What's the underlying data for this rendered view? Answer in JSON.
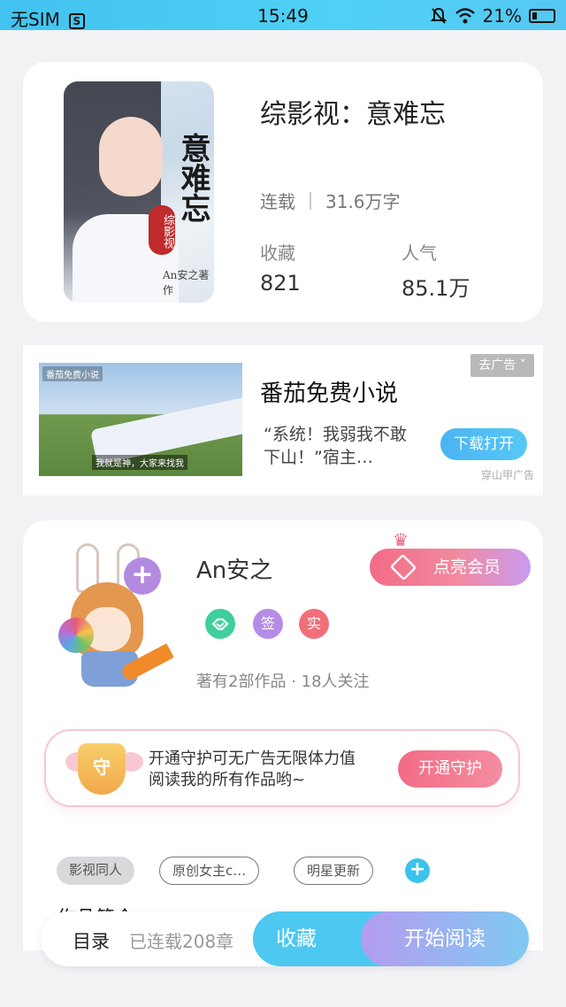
{
  "status_bar": {
    "carrier": "无SIM",
    "sim_icon": "S",
    "time": "15:49",
    "battery": "21%",
    "icons": [
      "silent-bell-icon",
      "wifi-icon",
      "battery-charging-icon"
    ]
  },
  "book": {
    "title": "综影视：意难忘",
    "status": "连载",
    "word_count": "31.6万字",
    "favorites_label": "收藏",
    "favorites_value": "821",
    "popularity_label": "人气",
    "popularity_value": "85.1万",
    "cover": {
      "calligraphy": "意难忘",
      "seal_text": "综影视",
      "credit": "An安之著作"
    }
  },
  "ad": {
    "thumb_brand": "番茄免费小说",
    "thumb_caption": "我就是神，大家来找我",
    "title": "番茄免费小说",
    "description": "“系统！我弱我不敢下山！”宿主…",
    "remove_label": "去广告 ˅",
    "cta_label": "下载打开",
    "source_label": "穿山甲广告"
  },
  "author": {
    "name": "An安之",
    "follow_icon": "+",
    "vip_label": "点亮会员",
    "vip_crown": "♛",
    "badges": [
      {
        "text": "",
        "icon": "handshake-icon",
        "color": "#3fcf9a"
      },
      {
        "text": "签",
        "icon": "signed-icon",
        "color": "#b58ce6"
      },
      {
        "text": "实",
        "icon": "verified-icon",
        "color": "#f0707a"
      }
    ],
    "works_info": "著有2部作品 · 18人关注"
  },
  "guard": {
    "emblem_text": "守",
    "text": "开通守护可无广告无限体力值阅读我的所有作品哟~",
    "button_label": "开通守护"
  },
  "tags": {
    "items": [
      "影视同人",
      "原创女主c…",
      "明星更新"
    ],
    "add_label": "+"
  },
  "intro": {
    "heading": "作品简介"
  },
  "bottom_bar": {
    "toc_label": "目录",
    "chapters_label": "已连载208章",
    "favorite_label": "收藏",
    "read_label": "开始阅读"
  },
  "colors": {
    "accent_blue": "#4dc8f0",
    "accent_pink": "#f26b86",
    "accent_purple": "#b49cf0"
  }
}
